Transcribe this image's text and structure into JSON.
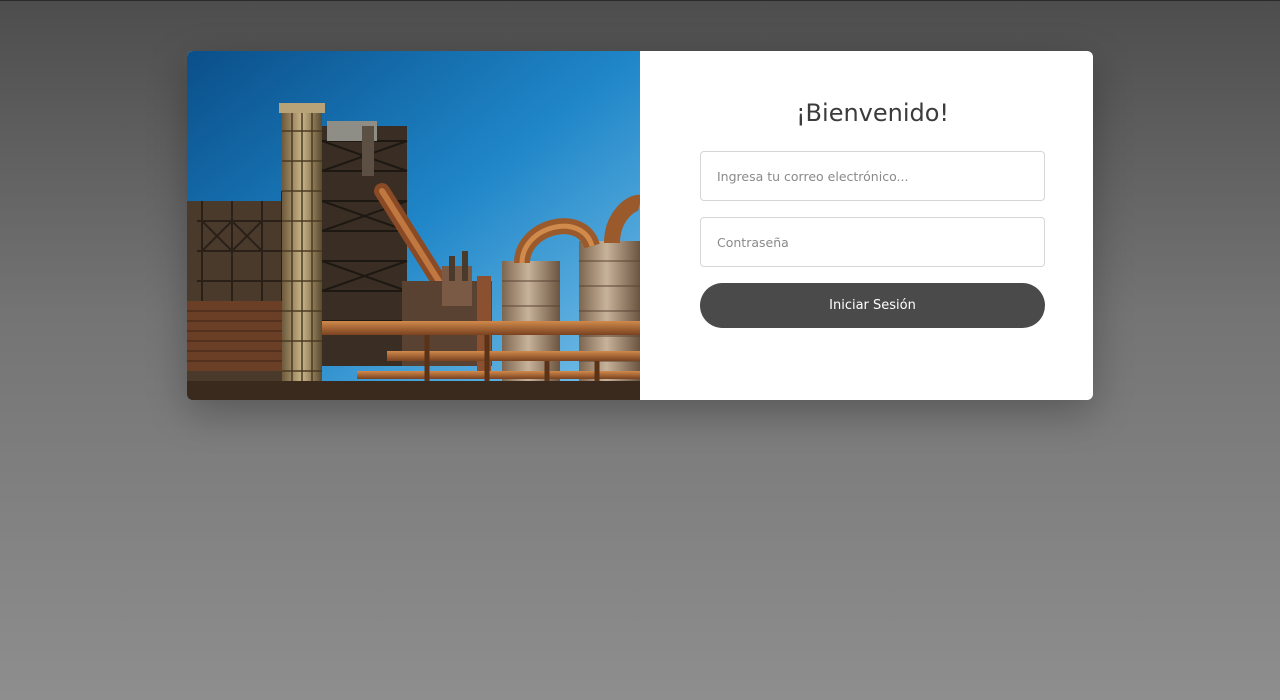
{
  "login": {
    "title": "¡Bienvenido!",
    "email_placeholder": "Ingresa tu correo electrónico...",
    "password_placeholder": "Contraseña",
    "submit_label": "Iniciar Sesión"
  },
  "colors": {
    "button": "#4a4a4a",
    "card": "#ffffff",
    "sky": "#1f86c8",
    "rust": "#9a5a2c"
  },
  "hero": {
    "subject": "industrial-plant-image"
  }
}
